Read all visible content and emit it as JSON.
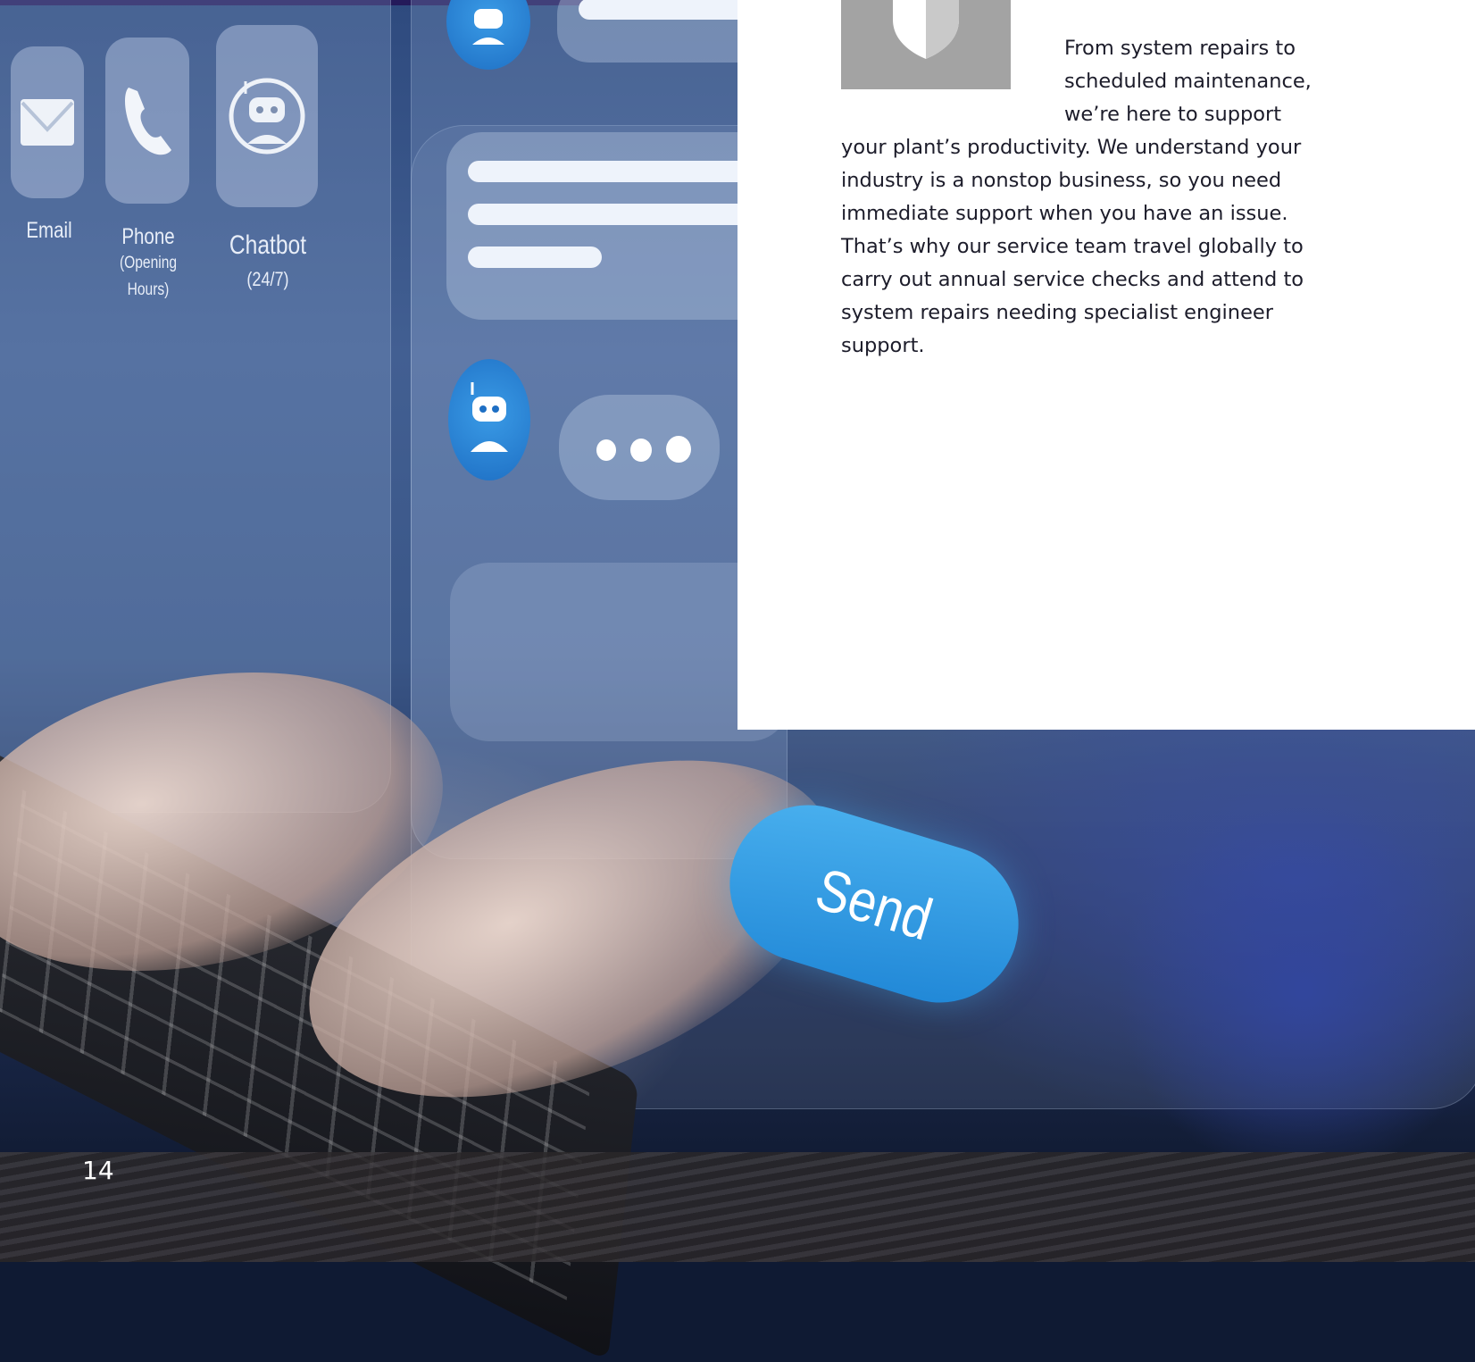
{
  "contact_panel": {
    "email_label": "Email",
    "phone_label": "Phone",
    "phone_sublabel": "(Opening Hours)",
    "chatbot_label": "Chatbot",
    "chatbot_sublabel": "(24/7)"
  },
  "chat": {
    "send_label": "Send"
  },
  "card": {
    "body": "From system repairs to scheduled maintenance, we’re here to support your plant’s productivity. We understand your industry is a nonstop business, so you need immediate support when you have an issue. That’s why our service team travel globally to carry out annual service checks and attend to system repairs needing specialist engineer support."
  },
  "page_number": "14",
  "colors": {
    "top_bar": "#241a5a",
    "icon_box": "#a3a3a3",
    "send_button": "#2a95e0",
    "text": "#1c1c2a"
  },
  "icons": [
    "shield-icon",
    "envelope-icon",
    "phone-icon",
    "robot-icon"
  ]
}
